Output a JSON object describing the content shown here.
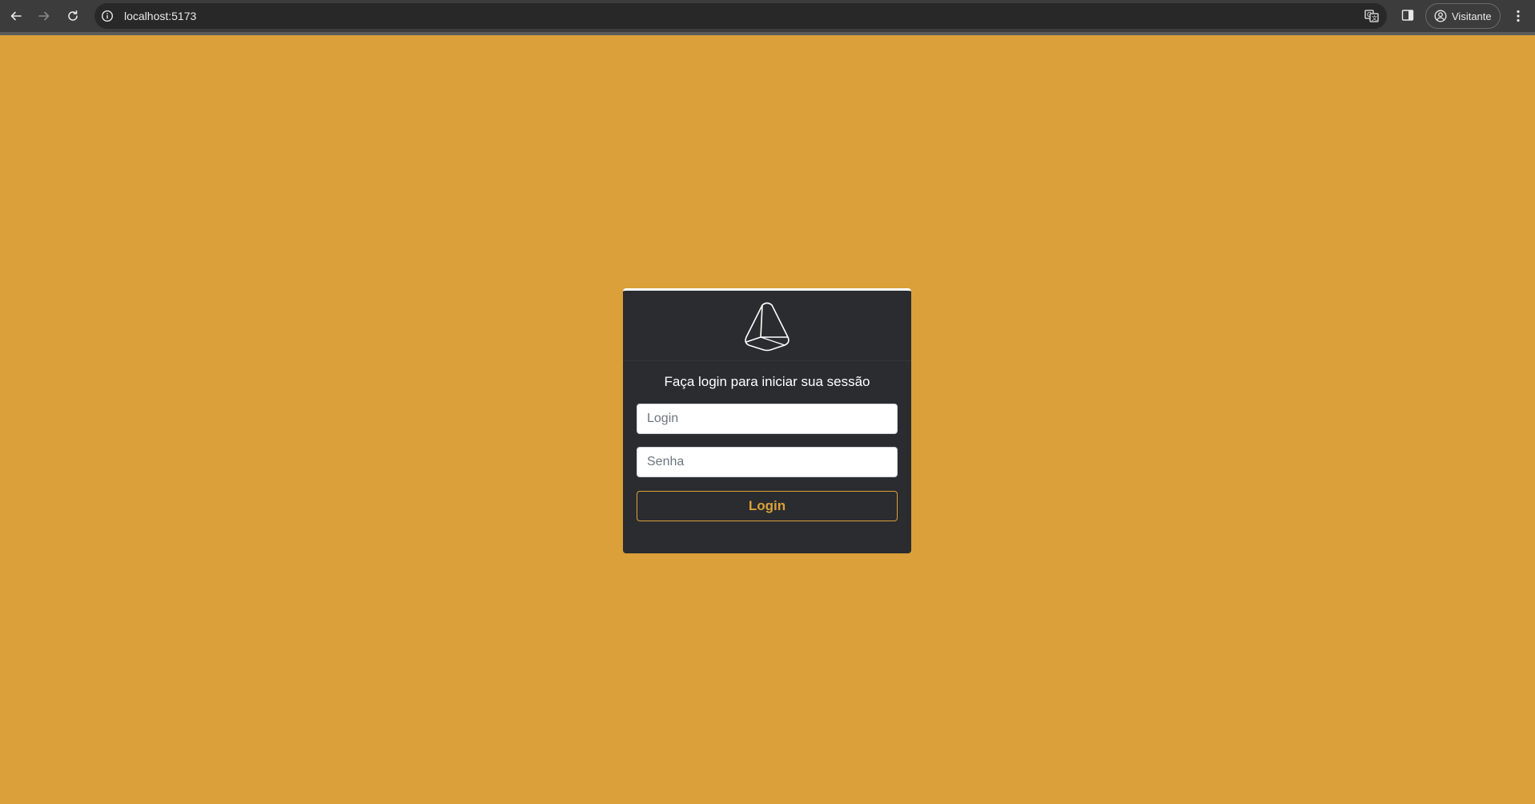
{
  "browser": {
    "url": "localhost:5173",
    "profile_label": "Visitante",
    "icons": {
      "back": "arrow-left-icon",
      "forward": "arrow-right-icon",
      "reload": "reload-icon",
      "site_info": "info-icon",
      "translate": "translate-icon",
      "side_panel": "side-panel-icon",
      "profile": "avatar-icon",
      "menu": "kebab-menu-icon"
    }
  },
  "page": {
    "background_color": "#dba039",
    "card_color": "#2a2c30"
  },
  "login": {
    "logo": "triangle-logo-icon",
    "title": "Faça login para iniciar sua sessão",
    "login_placeholder": "Login",
    "login_value": "",
    "password_placeholder": "Senha",
    "password_value": "",
    "submit_label": "Login",
    "accent_color": "#dba039"
  }
}
